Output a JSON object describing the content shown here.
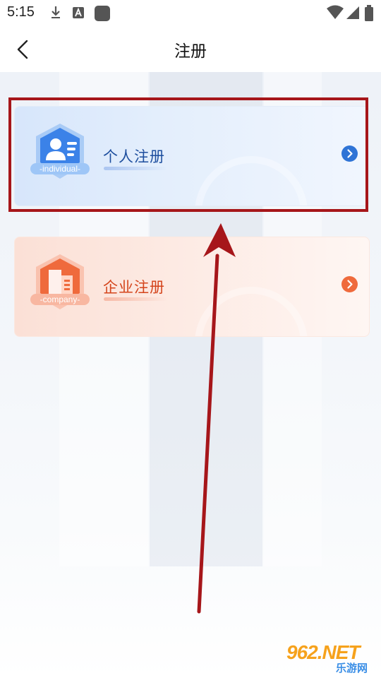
{
  "status_bar": {
    "time": "5:15",
    "icons": [
      "download-icon",
      "a-app-icon",
      "app-square-icon",
      "wifi-icon",
      "signal-icon",
      "battery-icon"
    ]
  },
  "header": {
    "back_icon": "chevron-left-icon",
    "title": "注册"
  },
  "options": [
    {
      "label": "个人注册",
      "badge_text": "-individual-",
      "icon": "person-id-icon",
      "accent": "#2f74d6",
      "label_color": "#1d4e9e"
    },
    {
      "label": "企业注册",
      "badge_text": "-company-",
      "icon": "building-icon",
      "accent": "#ef6a3c",
      "label_color": "#d4441b"
    }
  ],
  "annotation": {
    "box_color": "#a6161a",
    "arrow_color": "#a6161a"
  },
  "watermark": {
    "brand": "962.NET",
    "site": "乐游网"
  }
}
